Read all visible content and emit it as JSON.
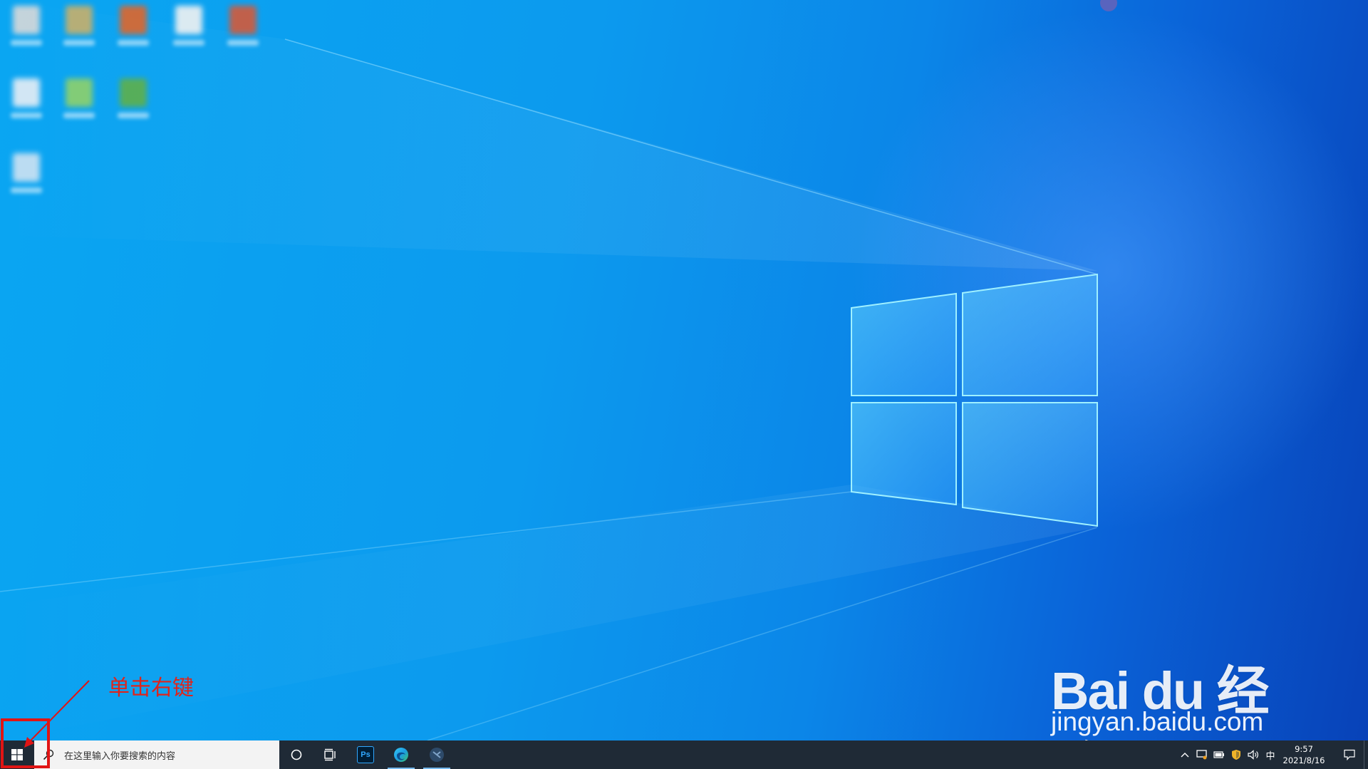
{
  "desktop": {
    "icons": [
      {
        "name": "desktop-icon-1",
        "color": "#d9d9d9"
      },
      {
        "name": "desktop-icon-2",
        "color": "#c9b06a"
      },
      {
        "name": "desktop-icon-3",
        "color": "#e0662a"
      },
      {
        "name": "desktop-icon-4",
        "color": "#f2f2f2"
      },
      {
        "name": "desktop-icon-5",
        "color": "#d45a3a"
      },
      {
        "name": "desktop-icon-6",
        "color": "#e8eef5"
      },
      {
        "name": "desktop-icon-7",
        "color": "#8fd16a"
      },
      {
        "name": "desktop-icon-8",
        "color": "#5fb04a"
      },
      {
        "name": "desktop-icon-9",
        "color": "#cfe3f2"
      }
    ]
  },
  "annotation": {
    "label": "单击右键",
    "color": "#e11414"
  },
  "watermark": {
    "logo_text": "Bai du 经验",
    "url": "jingyan.baidu.com"
  },
  "taskbar": {
    "search_placeholder": "在这里输入你要搜索的内容",
    "apps": [
      {
        "name": "cortana",
        "icon": "circle-icon"
      },
      {
        "name": "task-view",
        "icon": "task-view-icon"
      },
      {
        "name": "photoshop",
        "icon": "photoshop-icon",
        "label": "Ps"
      },
      {
        "name": "edge",
        "icon": "edge-icon"
      },
      {
        "name": "app",
        "icon": "app-icon"
      }
    ],
    "tray": {
      "ime_label": "中",
      "time": "9:57",
      "date": "2021/8/16"
    },
    "background": "#1f2a36"
  }
}
